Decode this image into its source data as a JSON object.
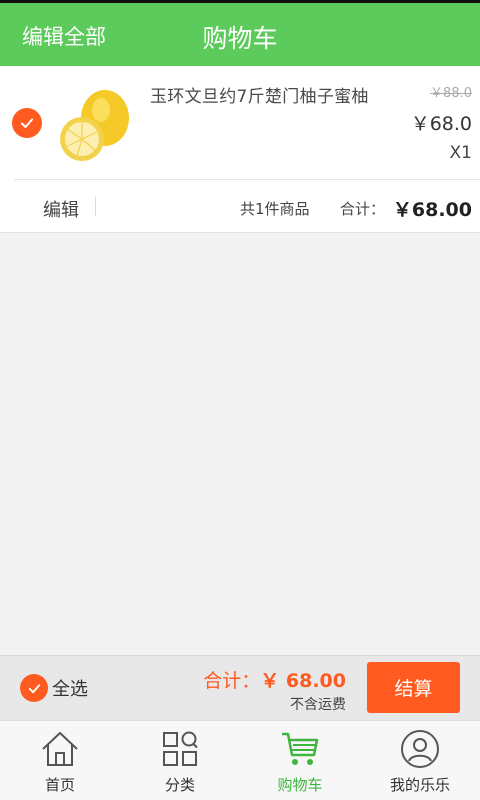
{
  "header": {
    "edit_all_label": "编辑全部",
    "title": "购物车"
  },
  "cart": {
    "items": [
      {
        "name": "玉环文旦约7斤楚门柚子蜜柚",
        "original_price": "￥88.0",
        "price": "￥68.0",
        "quantity": "X1",
        "checked": true,
        "image_icon": "pomelo-image"
      }
    ],
    "store_footer": {
      "edit_label": "编辑",
      "count_text": "共1件商品",
      "subtotal_label": "合计：",
      "subtotal_value": "￥68.00"
    }
  },
  "checkout_bar": {
    "select_all_label": "全选",
    "select_all_checked": true,
    "total_label": "合计：",
    "total_value": "￥ 68.00",
    "shipping_note": "不含运费",
    "checkout_label": "结算"
  },
  "tabbar": {
    "items": [
      {
        "label": "首页",
        "icon": "home-icon",
        "active": false
      },
      {
        "label": "分类",
        "icon": "category-icon",
        "active": false
      },
      {
        "label": "购物车",
        "icon": "cart-icon",
        "active": true
      },
      {
        "label": "我的乐乐",
        "icon": "profile-icon",
        "active": false
      }
    ]
  },
  "colors": {
    "header_green": "#5ccb5c",
    "accent_orange": "#ff5a1f",
    "active_tab_green": "#3fb43f"
  }
}
